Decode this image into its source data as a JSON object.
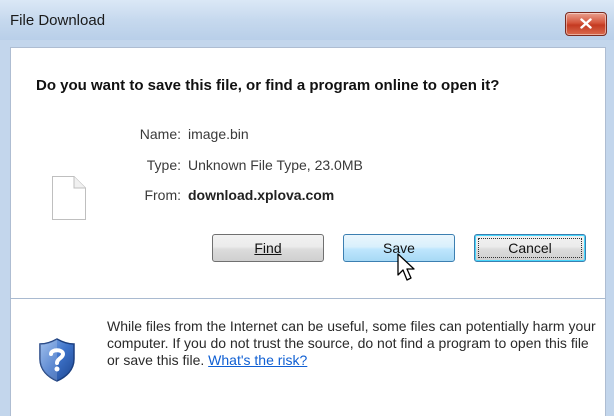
{
  "window": {
    "title": "File Download"
  },
  "dialog": {
    "question": "Do you want to save this file, or find a program online to open it?",
    "info": {
      "name_label": "Name:",
      "name_value": "image.bin",
      "type_label": "Type:",
      "type_value": "Unknown File Type, 23.0MB",
      "from_label": "From:",
      "from_value": "download.xplova.com"
    },
    "buttons": {
      "find_label": "Find",
      "save_label": "Save",
      "cancel_label": "Cancel"
    },
    "warning": {
      "text": "While files from the Internet can be useful, some files can potentially harm your computer. If you do not trust the source, do not find a program to open this file or save this file.",
      "link": "What's the risk?"
    }
  },
  "icons": {
    "close": "close-icon",
    "file": "file-icon",
    "shield": "shield-question-icon",
    "cursor": "mouse-cursor-icon"
  },
  "colors": {
    "titlebar": "#c6d9ee",
    "close_button": "#c43a21",
    "link": "#0f5fd3",
    "shield": "#2d63b8"
  }
}
